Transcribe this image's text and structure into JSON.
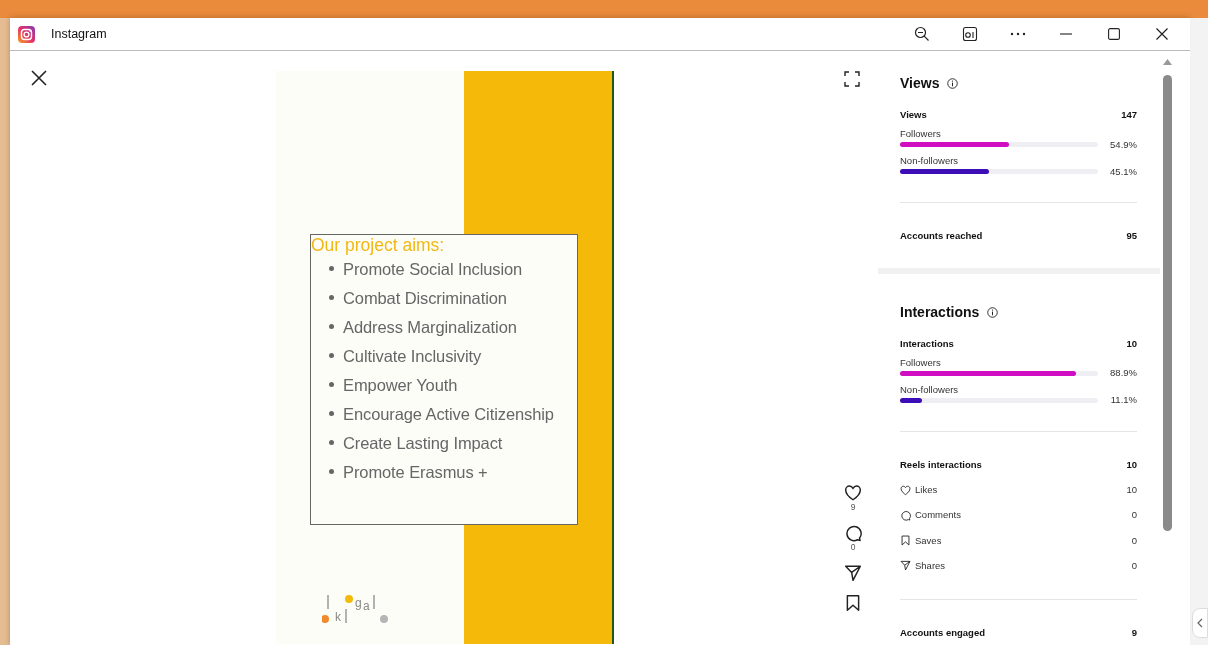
{
  "window": {
    "title": "Instagram"
  },
  "post": {
    "heading": "Our project aims:",
    "items": [
      "Promote Social Inclusion",
      "Combat Discrimination",
      "Address Marginalization",
      "Cultivate Inclusivity",
      "Empower Youth",
      "Encourage Active Citizenship",
      "Create Lasting Impact",
      "Promote Erasmus +"
    ],
    "logo_letters": [
      "k",
      "g",
      "a"
    ]
  },
  "actions": [
    {
      "kind": "like",
      "count": "9"
    },
    {
      "kind": "comment",
      "count": "0"
    },
    {
      "kind": "share"
    },
    {
      "kind": "save"
    }
  ],
  "insights": [
    {
      "title": "Views",
      "groups": [
        {
          "label": "Views",
          "value": "147",
          "bars": [
            {
              "label": "Followers",
              "level": 0.549,
              "reading": "54.9%",
              "color": "#d10dc2"
            },
            {
              "label": "Non-followers",
              "level": 0.451,
              "reading": "45.1%",
              "color": "#3d0db8"
            }
          ]
        },
        {
          "label": "Accounts reached",
          "value": "95"
        }
      ]
    },
    {
      "title": "Interactions",
      "groups": [
        {
          "label": "Interactions",
          "value": "10",
          "bars": [
            {
              "label": "Followers",
              "level": 0.889,
              "reading": "88.9%",
              "color": "#d10dc2"
            },
            {
              "label": "Non-followers",
              "level": 0.111,
              "reading": "11.1%",
              "color": "#3d0db8"
            }
          ]
        },
        {
          "label": "Reels interactions",
          "value": "10",
          "items": [
            {
              "kind": "like",
              "label": "Likes",
              "value": "10"
            },
            {
              "kind": "comment",
              "label": "Comments",
              "value": "0"
            },
            {
              "kind": "save",
              "label": "Saves",
              "value": "0"
            },
            {
              "kind": "share",
              "label": "Shares",
              "value": "0"
            }
          ]
        },
        {
          "label": "Accounts engaged",
          "value": "9"
        }
      ]
    }
  ]
}
